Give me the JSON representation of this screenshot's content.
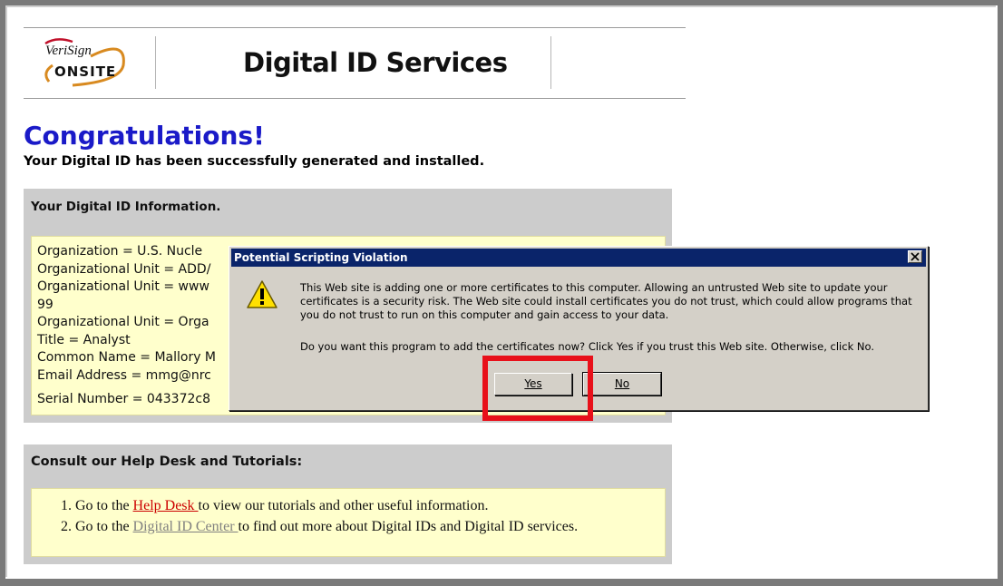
{
  "header": {
    "logo_text_top": "VeriSign",
    "logo_text_bottom": "ONSITE",
    "title": "Digital ID Services"
  },
  "congrats": {
    "heading": "Congratulations!",
    "subheading": "Your Digital ID has been successfully generated and installed."
  },
  "id_info": {
    "heading": "Your Digital ID Information.",
    "lines": [
      "Organization = U.S. Nucle",
      "Organizational Unit = ADD/",
      "Organizational Unit = www",
      "99",
      "Organizational Unit = Orga",
      "Title = Analyst",
      "Common Name = Mallory M",
      "Email Address = mmg@nrc",
      "Serial Number = 043372c8"
    ]
  },
  "help": {
    "heading": "Consult our Help Desk and Tutorials:",
    "items": [
      {
        "prefix": "Go to the ",
        "link": "Help Desk ",
        "suffix": "to view our tutorials and other useful information."
      },
      {
        "prefix": "Go to the ",
        "link": "Digital ID Center ",
        "suffix": "to find out more about Digital IDs and Digital ID services."
      }
    ]
  },
  "dialog": {
    "title": "Potential Scripting Violation",
    "message": "This Web site is adding one or more certificates to this computer. Allowing an untrusted Web site to update your certificates is a security risk. The Web site could install certificates you do not trust, which could allow programs that you do not trust to run on this computer and gain access to your data.",
    "question": "Do you want this program to add the certificates now? Click Yes if you trust this Web site. Otherwise, click No.",
    "yes_label": "Yes",
    "no_label": "No"
  },
  "colors": {
    "heading_blue": "#1a1ac8",
    "panel_grey": "#cccccc",
    "panel_yellow": "#ffffcc",
    "dialog_title_bar": "#0a246a",
    "highlight_red": "#e8101a",
    "link_red": "#cc0000"
  }
}
